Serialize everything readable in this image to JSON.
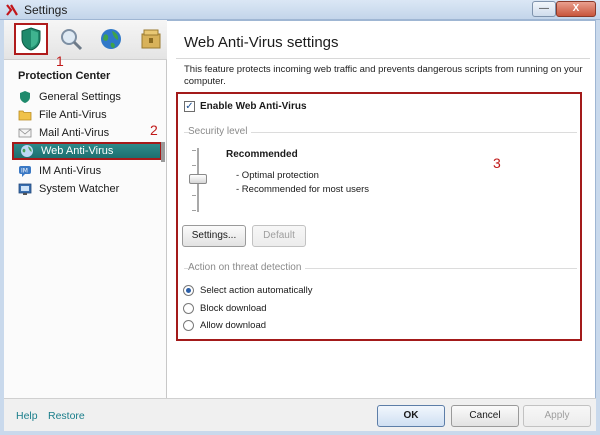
{
  "window": {
    "title": "Settings",
    "minimize_glyph": "—",
    "close_glyph": "X"
  },
  "nav_icons": [
    "protection-shield-icon",
    "scan-magnifier-icon",
    "update-globe-icon",
    "storage-box-icon"
  ],
  "annotations": {
    "a1": "1",
    "a2": "2",
    "a3": "3"
  },
  "sidebar": {
    "section_title": "Protection Center",
    "items": [
      {
        "label": "General Settings",
        "icon": "shield-icon"
      },
      {
        "label": "File Anti-Virus",
        "icon": "folder-icon"
      },
      {
        "label": "Mail Anti-Virus",
        "icon": "envelope-icon"
      },
      {
        "label": "Web Anti-Virus",
        "icon": "globe-icon"
      },
      {
        "label": "IM Anti-Virus",
        "icon": "chat-icon"
      },
      {
        "label": "System Watcher",
        "icon": "monitor-icon"
      }
    ],
    "active_index": 3
  },
  "main": {
    "heading": "Web Anti-Virus settings",
    "description": "This feature protects incoming web traffic and prevents dangerous scripts from running on your computer.",
    "enable_label": "Enable Web Anti-Virus",
    "enable_checked": true,
    "security_group_label": "Security level",
    "level": {
      "title": "Recommended",
      "line1": "- Optimal protection",
      "line2": "- Recommended for most users"
    },
    "settings_button": "Settings...",
    "default_button": "Default",
    "action_group_label": "Action on threat detection",
    "actions": [
      {
        "label": "Select action automatically",
        "selected": true
      },
      {
        "label": "Block download",
        "selected": false
      },
      {
        "label": "Allow download",
        "selected": false
      }
    ]
  },
  "footer": {
    "help": "Help",
    "restore": "Restore",
    "ok": "OK",
    "cancel": "Cancel",
    "apply": "Apply"
  },
  "colors": {
    "annotation_red": "#a31a1a",
    "active_item": "#1d6f6f",
    "link": "#1a7e8b"
  }
}
